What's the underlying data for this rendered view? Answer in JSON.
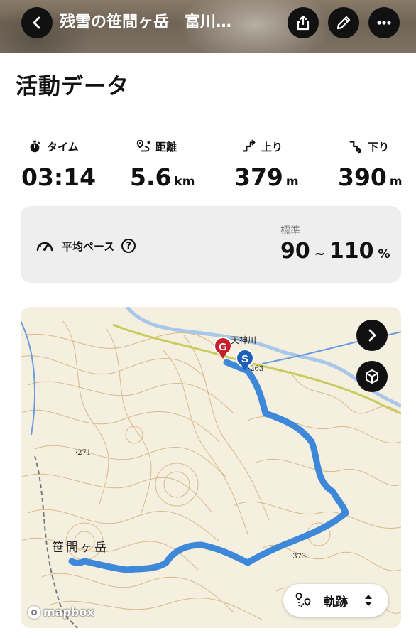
{
  "header": {
    "title": "残雪の笹間ヶ岳　富川…",
    "buttons": {
      "back": "chevron-left-icon",
      "share": "share-icon",
      "edit": "pencil-icon",
      "more": "more-icon"
    }
  },
  "section_title": "活動データ",
  "stats": {
    "time": {
      "label": "タイム",
      "value": "03:14",
      "unit": ""
    },
    "distance": {
      "label": "距離",
      "value": "5.6",
      "unit": "km"
    },
    "ascent": {
      "label": "上り",
      "value": "379",
      "unit": "m"
    },
    "descent": {
      "label": "下り",
      "value": "390",
      "unit": "m"
    }
  },
  "pace": {
    "label": "平均ペース",
    "help": "?",
    "standard_label": "標準",
    "min": "90",
    "separator": "~",
    "max": "110",
    "unit": "%"
  },
  "map": {
    "labels": {
      "river": "天神川",
      "peak": "笹間ヶ岳",
      "elev_271": "271",
      "elev_263": "263",
      "elev_373": "373"
    },
    "markers": {
      "goal": "G",
      "start": "S"
    },
    "track_button": {
      "label": "軌跡"
    },
    "attribution": "mapbox",
    "colors": {
      "route": "#3d88d8",
      "goal": "#c8202a",
      "start": "#1f5fb8",
      "contour": "#d9b98a",
      "map_bg": "#f4efdf"
    }
  }
}
